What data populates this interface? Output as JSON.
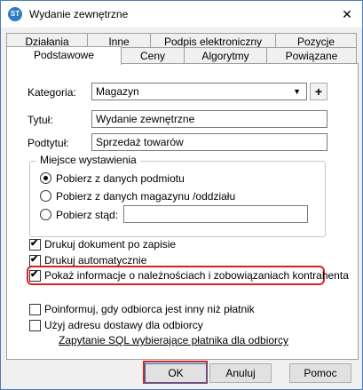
{
  "window": {
    "title": "Wydanie zewnętrzne",
    "icon": "app-logo-icon",
    "close_icon": "close-icon"
  },
  "tabs_row1": [
    "Działania",
    "Inne",
    "Podpis elektroniczny",
    "Pozycje"
  ],
  "tabs_row2": [
    "Podstawowe",
    "Ceny",
    "Algorytmy",
    "Powiązane"
  ],
  "active_tab": "Podstawowe",
  "form": {
    "category_label": "Kategoria:",
    "category_value": "Magazyn",
    "add_label": "+",
    "title_label": "Tytuł:",
    "title_value": "Wydanie zewnętrzne",
    "subtitle_label": "Podtytuł:",
    "subtitle_value": "Sprzedaż towarów"
  },
  "issue_place": {
    "group_title": "Miejsce wystawienia",
    "options": [
      "Pobierz z danych podmiotu",
      "Pobierz z danych magazynu /oddziału",
      "Pobierz stąd:"
    ],
    "selected_index": 0,
    "custom_value": ""
  },
  "checkboxes": [
    {
      "label": "Drukuj dokument po zapisie",
      "checked": true
    },
    {
      "label": "Drukuj automatycznie",
      "checked": true
    },
    {
      "label": "Pokaż informacje o należnościach i zobowiązaniach kontrahenta",
      "checked": true
    },
    {
      "label": "Poinformuj, gdy odbiorca jest inny niż płatnik",
      "checked": false
    },
    {
      "label": "Użyj adresu dostawy dla odbiorcy",
      "checked": false
    }
  ],
  "sql_link": "Zapytanie SQL wybierające płatnika dla odbiorcy",
  "buttons": {
    "ok": "OK",
    "cancel": "Anuluj",
    "help": "Pomoc"
  },
  "colors": {
    "highlight": "#e02020",
    "frame": "#4a7db8"
  }
}
